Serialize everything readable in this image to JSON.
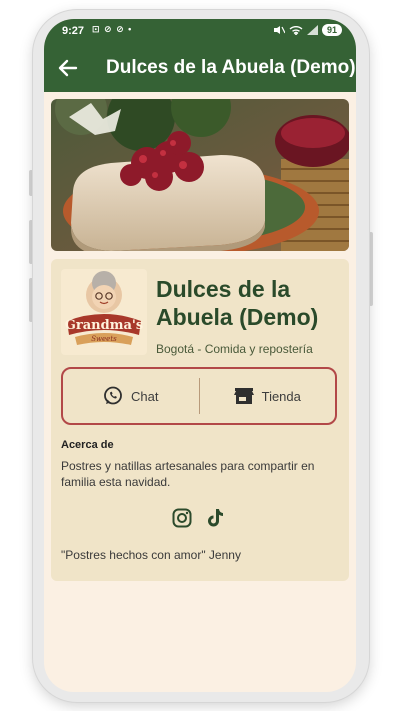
{
  "status_bar": {
    "time": "9:27",
    "left_icons": "⊡ ⊘ ⊘ •",
    "battery": "91"
  },
  "app_bar": {
    "title": "Dulces de la Abuela (Demo)",
    "back_icon": "arrow-left-icon"
  },
  "store": {
    "name": "Dulces de la Abuela (Demo)",
    "subtitle": "Bogotá - Comida y repostería",
    "logo_text_top": "Grandma's",
    "logo_text_bottom": "Sweets"
  },
  "actions": [
    {
      "label": "Chat",
      "icon": "whatsapp-icon"
    },
    {
      "label": "Tienda",
      "icon": "storefront-icon"
    }
  ],
  "about": {
    "heading": "Acerca de",
    "text": "Postres y natillas artesanales para compartir en familia esta navidad."
  },
  "socials": [
    {
      "icon": "instagram-icon"
    },
    {
      "icon": "tiktok-icon"
    }
  ],
  "quote": "\"Postres hechos con amor\" Jenny",
  "colors": {
    "primary": "#356235",
    "background": "#fbf0e3",
    "card": "#f0e4c8",
    "accent_border": "#b24848",
    "heading_text": "#2a4a2a"
  }
}
